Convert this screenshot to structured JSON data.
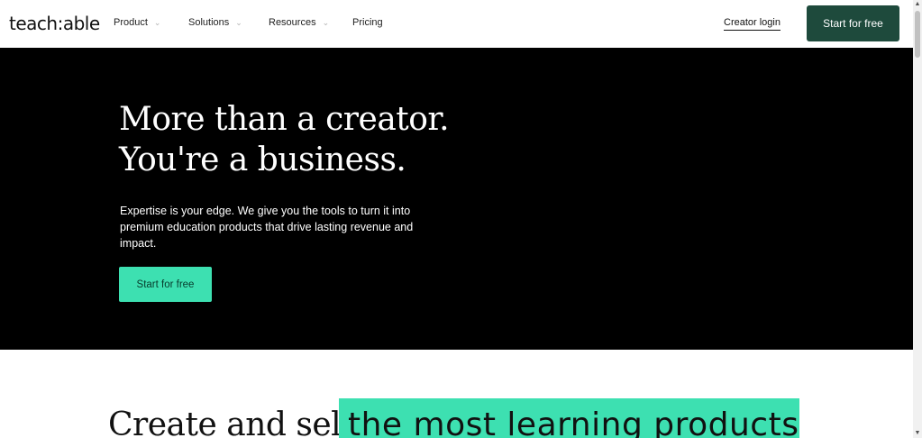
{
  "nav": {
    "logo": "teach:able",
    "items": [
      {
        "label": "Product",
        "has_dropdown": true
      },
      {
        "label": "Solutions",
        "has_dropdown": true
      },
      {
        "label": "Resources",
        "has_dropdown": true
      },
      {
        "label": "Pricing",
        "has_dropdown": false
      }
    ],
    "login_label": "Creator login",
    "cta_label": "Start for free"
  },
  "hero": {
    "title_line1": "More than a creator.",
    "title_line2": "You're a business.",
    "subtitle": "Expertise is your edge. We give you the tools to turn it into premium education products that drive lasting revenue and impact.",
    "cta_label": "Start for free"
  },
  "section2": {
    "heading_plain": "Create and sell",
    "heading_highlight": "the most learning products"
  },
  "icons": {
    "chevron": "chevron-down-icon",
    "scroll_up": "scroll-up-arrow-icon",
    "scroll_down": "scroll-down-arrow-icon"
  },
  "colors": {
    "brand_dark_green": "#1e4a3c",
    "accent_mint": "#3de0b1",
    "hero_bg": "#000000"
  }
}
